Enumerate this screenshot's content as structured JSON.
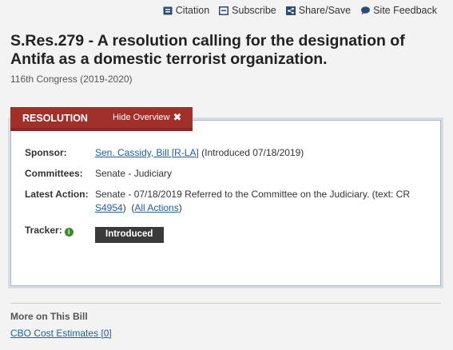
{
  "toolbar": {
    "citation": "Citation",
    "subscribe": "Subscribe",
    "share_save": "Share/Save",
    "site_feedback": "Site Feedback"
  },
  "bill": {
    "title": "S.Res.279 - A resolution calling for the designation of Antifa as a domestic terrorist organization.",
    "congress": "116th Congress (2019-2020)"
  },
  "tabs": {
    "resolution": "RESOLUTION",
    "hide_overview": "Hide Overview",
    "hide_icon": "✖"
  },
  "overview": {
    "sponsor_label": "Sponsor:",
    "sponsor_name": "Sen. Cassidy, Bill [R-LA]",
    "sponsor_date": "(Introduced 07/18/2019)",
    "committees_label": "Committees:",
    "committees_value": "Senate - Judiciary",
    "latest_action_label": "Latest Action:",
    "latest_action_text": "Senate - 07/18/2019 Referred to the Committee on the Judiciary. (text: CR",
    "latest_action_cr": "S4954",
    "latest_action_close": ")",
    "all_actions_open": "(",
    "all_actions": "All Actions",
    "all_actions_close": ")",
    "tracker_label": "Tracker:",
    "tracker_status": "Introduced"
  },
  "more": {
    "title": "More on This Bill",
    "cbo_link": "CBO Cost Estimates [0]"
  },
  "colors": {
    "tab_red": "#a1302b",
    "link_blue": "#1f5ea8",
    "tracker_badge": "#3a3a3a",
    "info_green": "#3b8a2e"
  },
  "icons": {
    "citation": "citation-icon",
    "subscribe": "subscribe-icon",
    "share": "share-icon",
    "feedback": "feedback-icon",
    "tracker_info": "info-icon"
  }
}
